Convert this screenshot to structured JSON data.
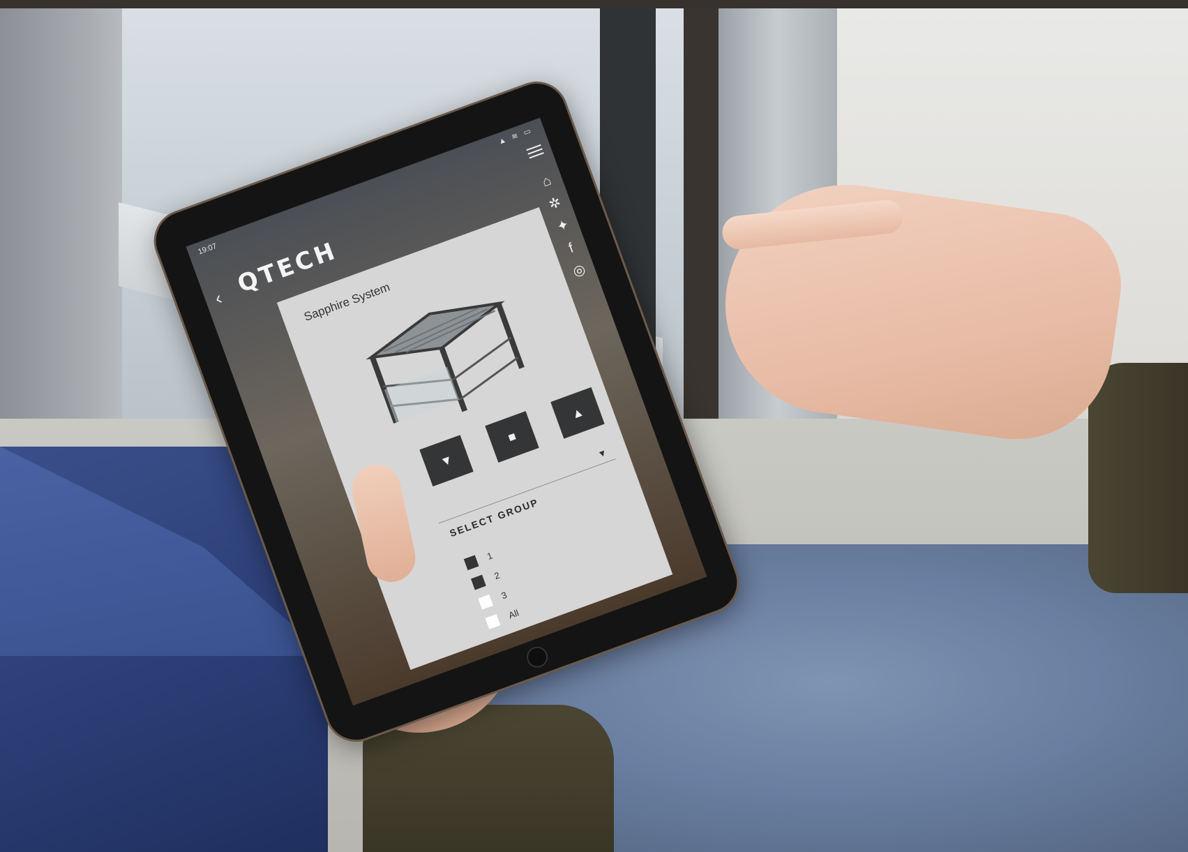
{
  "status_bar": {
    "time": "19:07",
    "icons": "▲ ≋ ▭"
  },
  "app": {
    "logo": "QTECH",
    "back_symbol": "‹",
    "title": "Sapphire System"
  },
  "rail": [
    {
      "name": "home",
      "glyph": "⌂"
    },
    {
      "name": "settings",
      "glyph": "✲"
    },
    {
      "name": "twitter",
      "glyph": "✦"
    },
    {
      "name": "facebook",
      "glyph": "f"
    },
    {
      "name": "instagram",
      "glyph": "◎"
    }
  ],
  "controls": {
    "down": "▼",
    "stop": "■",
    "up": "▲",
    "caret": "▼"
  },
  "select_group": {
    "label": "SELECT GROUP",
    "items": [
      {
        "label": "1",
        "checked": true
      },
      {
        "label": "2",
        "checked": true
      },
      {
        "label": "3",
        "checked": false
      },
      {
        "label": "All",
        "checked": false
      }
    ]
  },
  "colors": {
    "panel": "#d6d6d6",
    "button": "#333536",
    "checked_box": "#333536",
    "unchecked_box": "#ffffff"
  }
}
